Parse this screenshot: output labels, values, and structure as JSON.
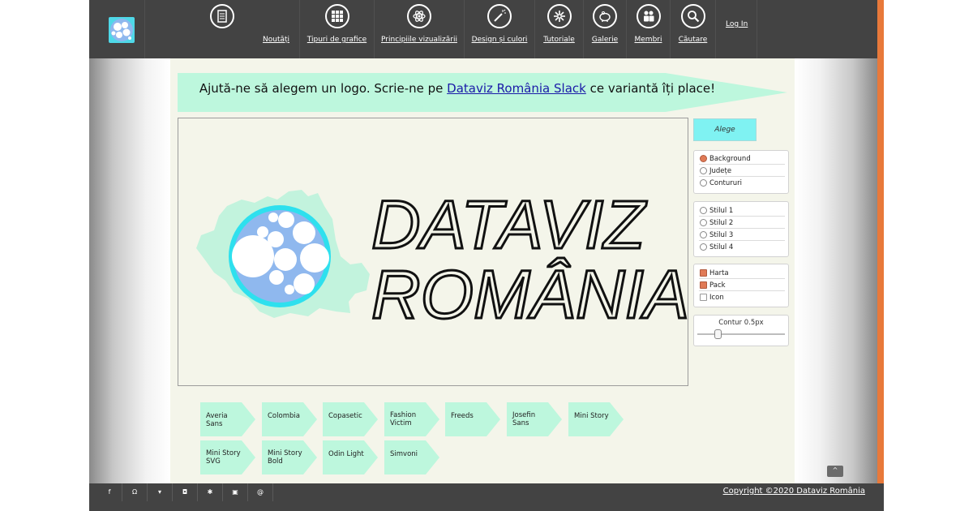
{
  "nav": {
    "items": [
      {
        "label": "Noutăți",
        "icon": "document-icon"
      },
      {
        "label": "Tipuri de grafice",
        "icon": "grid-icon"
      },
      {
        "label": "Principiile vizualizării",
        "icon": "atom-icon"
      },
      {
        "label": "Design și culori",
        "icon": "magic-wand-icon"
      },
      {
        "label": "Tutoriale",
        "icon": "compass-icon"
      },
      {
        "label": "Galerie",
        "icon": "piggy-bank-icon"
      },
      {
        "label": "Membri",
        "icon": "people-icon"
      },
      {
        "label": "Căutare",
        "icon": "search-icon"
      }
    ],
    "login": "Log In"
  },
  "banner": {
    "before": "Ajută-ne să alegem un logo. Scrie-ne pe ",
    "link": "Dataviz România Slack",
    "after": " ce variantă îți place!"
  },
  "logo_preview": {
    "line1": "DATAVIZ",
    "line2": "ROMÂNIA"
  },
  "controls": {
    "choose_button": "Alege",
    "layers": [
      {
        "label": "Background",
        "selected": true
      },
      {
        "label": "Județe",
        "selected": false
      },
      {
        "label": "Contururi",
        "selected": false
      }
    ],
    "styles": [
      {
        "label": "Stilul 1",
        "selected": false
      },
      {
        "label": "Stilul 2",
        "selected": false
      },
      {
        "label": "Stilul 3",
        "selected": false
      },
      {
        "label": "Stilul 4",
        "selected": false
      }
    ],
    "elements": [
      {
        "label": "Harta",
        "checked": true
      },
      {
        "label": "Pack",
        "checked": true
      },
      {
        "label": "Icon",
        "checked": false
      }
    ],
    "slider": {
      "label": "Contur 0.5px",
      "value_fraction": 0.2
    }
  },
  "fonts": [
    "Averia Sans",
    "Colombia",
    "Copasetic",
    "Fashion Victim",
    "Freeds",
    "Josefin Sans",
    "Mini Story",
    "Mini Story SVG",
    "Mini Story Bold",
    "Odin Light",
    "Simvoni"
  ],
  "scroll_top": "^",
  "footer": {
    "social": [
      {
        "icon": "facebook-icon",
        "glyph": "f"
      },
      {
        "icon": "github-icon",
        "glyph": "Ω"
      },
      {
        "icon": "twitter-icon",
        "glyph": "▾"
      },
      {
        "icon": "instagram-icon",
        "glyph": "◘"
      },
      {
        "icon": "slack-icon",
        "glyph": "✱"
      },
      {
        "icon": "monitor-icon",
        "glyph": "▣"
      },
      {
        "icon": "email-icon",
        "glyph": "@"
      }
    ],
    "copyright": "Copyright ©2020 Dataviz România"
  },
  "colors": {
    "nav_bg": "#434343",
    "mint": "#bdf7dd",
    "cyan": "#4fd8e8",
    "accent_orange": "#e07a56",
    "link": "#1a1aa8"
  }
}
